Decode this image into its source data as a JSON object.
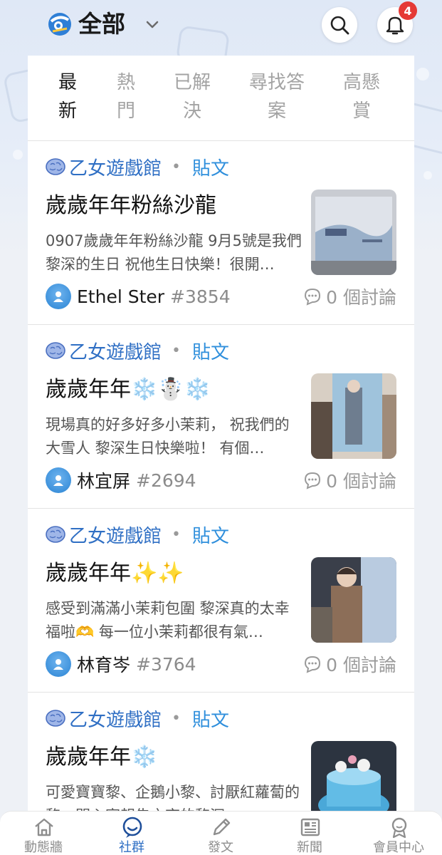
{
  "header": {
    "title": "全部",
    "logo_icon": "app-logo-icon",
    "chevron_icon": "chevron-down-icon",
    "search_icon": "search-icon",
    "bell_icon": "bell-icon",
    "notification_count": "4"
  },
  "tabs": [
    {
      "label": "最\n新",
      "active": true
    },
    {
      "label": "熱\n門",
      "active": false
    },
    {
      "label": "已解\n決",
      "active": false
    },
    {
      "label": "尋找答\n案",
      "active": false
    },
    {
      "label": "高懸\n賞",
      "active": false
    }
  ],
  "posts": [
    {
      "board": "乙女遊戲館",
      "dot": "•",
      "type": "貼文",
      "title": "歲歲年年粉絲沙龍",
      "excerpt": "0907歲歲年年粉絲沙龍 9月5號是我們黎深的生日 祝他生日快樂！很開…",
      "author": "Ethel Ster",
      "author_id": "#3854",
      "comments": "0 個討論"
    },
    {
      "board": "乙女遊戲館",
      "dot": "•",
      "type": "貼文",
      "title": "歲歲年年❄️☃️❄️",
      "excerpt": "現場真的好多好多小茉莉， 祝我們的大雪人 黎深生日快樂啦！ 有個…",
      "author": "林宜屏",
      "author_id": "#2694",
      "comments": "0 個討論"
    },
    {
      "board": "乙女遊戲館",
      "dot": "•",
      "type": "貼文",
      "title": "歲歲年年✨✨",
      "excerpt": "感受到滿滿小茉莉包圍 黎深真的太幸福啦🫶 每一位小茉莉都很有氣…",
      "author": "林育岑",
      "author_id": "#3764",
      "comments": "0 個討論"
    },
    {
      "board": "乙女遊戲館",
      "dot": "•",
      "type": "貼文",
      "title": "歲歲年年❄️",
      "excerpt": "可愛寶寶黎、企鵝小黎、討厭紅蘿蔔的黎、開心寫報告之夜的黎深",
      "author": "",
      "author_id": "",
      "comments": ""
    }
  ],
  "bottom_nav": [
    {
      "label": "動態牆",
      "icon": "home-icon",
      "active": false
    },
    {
      "label": "社群",
      "icon": "community-chat-icon",
      "active": true
    },
    {
      "label": "發文",
      "icon": "pencil-icon",
      "active": false
    },
    {
      "label": "新聞",
      "icon": "newspaper-icon",
      "active": false
    },
    {
      "label": "會員中心",
      "icon": "member-badge-icon",
      "active": false
    }
  ],
  "colors": {
    "accent_blue": "#2f6fc4",
    "type_blue": "#2f8fdc",
    "badge_red": "#e53935"
  }
}
